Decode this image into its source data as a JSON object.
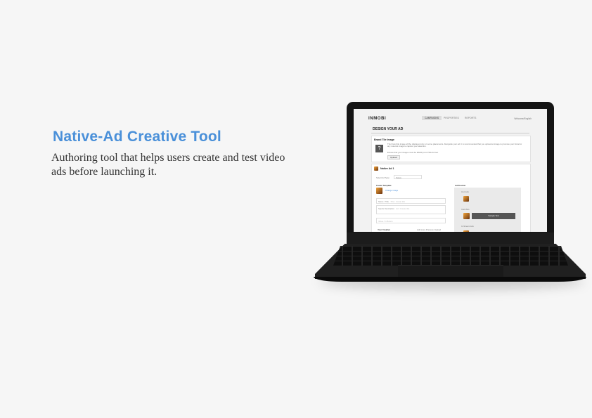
{
  "project": {
    "title": "Native-Ad Creative Tool",
    "description": "Authoring tool that helps users create and test video ads before launching it."
  },
  "colors": {
    "title": "#4a90d9",
    "background": "#f6f6f6",
    "laptop": "#141414"
  },
  "screen": {
    "logo": "INMOBI",
    "nav": [
      "CAMPAIGNS",
      "PROPERTIES",
      "REPORTS"
    ],
    "user": "Welcome/English",
    "page_heading": "DESIGN YOUR AD",
    "brand": {
      "title": "Brand Tile Image",
      "help": "The brand tile image will be displayed only on some placements. Alongside your ad. It is recommended that you upload an image to promote your brand or any relevant image to capture your attention.",
      "note": "Ensure that your images must be 90x90 px in PNG format.",
      "upload_label": "Upload",
      "placeholder_icon": "question-icon"
    },
    "native_ad": {
      "title": "Native Ad 1",
      "select_label": "Select Ad Type:",
      "select_value": "Native",
      "template_label": "Create Template",
      "change_image": "Change image",
      "name_label": "Name / Title",
      "name_placeholder": "Title / Create title",
      "desc_label": "Sports Description",
      "desc_placeholder": "Ad / Create title",
      "cta_placeholder": "Value / In Button",
      "creative_label": "Your Creative",
      "creative_actions": "Add more Preview | Upload",
      "preview_label": "Ad Preview",
      "preview_item_1": "Icon Ads",
      "preview_item_2": "Card Ads",
      "preview_button": "Sample Text",
      "preview_item_3": "In-Stream Ads"
    }
  }
}
